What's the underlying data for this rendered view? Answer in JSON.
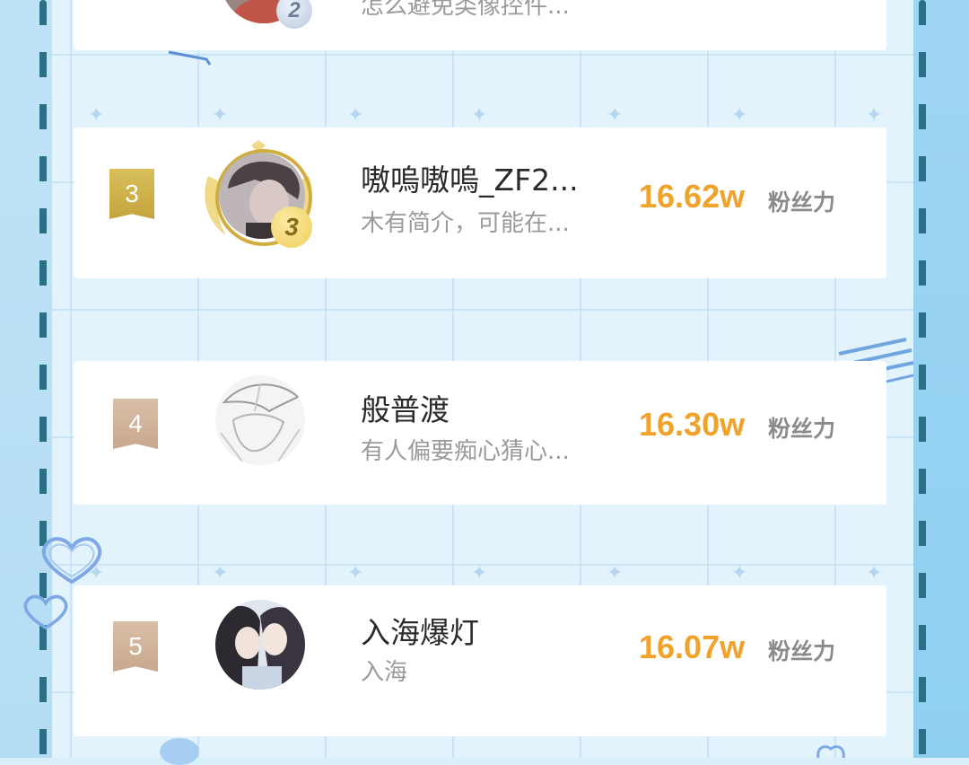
{
  "ranking": {
    "items": [
      {
        "rank_medal": "2",
        "bio": "怎么避免类像控件..."
      },
      {
        "rank": "3",
        "name": "嗷嗚嗷嗚_ZF2...",
        "bio": "木有简介，可能在...",
        "score": "16.62w",
        "score_label": "粉丝力",
        "rank_medal": "3"
      },
      {
        "rank": "4",
        "name": "般普渡",
        "bio": "有人偏要痴心猜心...",
        "score": "16.30w",
        "score_label": "粉丝力"
      },
      {
        "rank": "5",
        "name": "入海爆灯",
        "bio": "入海",
        "score": "16.07w",
        "score_label": "粉丝力"
      }
    ]
  },
  "colors": {
    "score": "#f0a32a",
    "rank_gold": "#c9a94a",
    "rank_tan": "#cdae95",
    "dash": "#2b6f86"
  },
  "icons": {
    "rank3_avatar_frame": "gold-wing-frame-icon",
    "medal": "rank-medal-icon",
    "decor_heart": "heart-outline-icon"
  }
}
